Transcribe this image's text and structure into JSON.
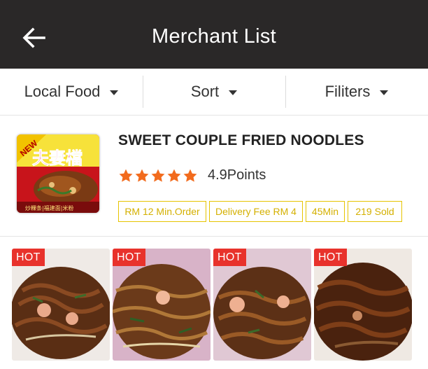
{
  "header": {
    "title": "Merchant List",
    "back_icon": "arrow-left-icon"
  },
  "filters": [
    {
      "label": "Local Food"
    },
    {
      "label": "Sort"
    },
    {
      "label": "Filiters"
    }
  ],
  "merchant": {
    "name": "SWEET COUPLE FRIED NOODLES",
    "logo_badge": "NEW",
    "logo_text": "夫妻檔",
    "logo_subtext": "炒粿条|福建面|米粉",
    "rating_stars": 5,
    "points": "4.9Points",
    "tags": [
      "RM 12 Min.Order",
      "Delivery Fee RM 4",
      "45Min",
      "219 Sold"
    ],
    "accent_color": "#f26b1d",
    "tag_color": "#e6c400"
  },
  "dishes": [
    {
      "badge": "HOT"
    },
    {
      "badge": "HOT"
    },
    {
      "badge": "HOT"
    },
    {
      "badge": "HOT"
    }
  ]
}
